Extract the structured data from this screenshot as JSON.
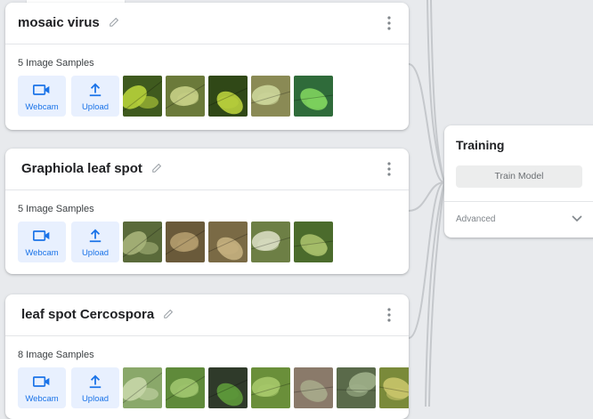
{
  "classes": [
    {
      "name": "mosaic virus",
      "samples_label": "5 Image Samples",
      "webcam_label": "Webcam",
      "upload_label": "Upload",
      "thumbnails": [
        {
          "bg": "#3f5a1e",
          "leaf": "#b7d13a"
        },
        {
          "bg": "#6b7a3a",
          "leaf": "#c7cf86"
        },
        {
          "bg": "#304817",
          "leaf": "#b9cf3c"
        },
        {
          "bg": "#8a8a55",
          "leaf": "#cbd59a"
        },
        {
          "bg": "#2f6b3a",
          "leaf": "#7fd35e"
        }
      ]
    },
    {
      "name": "Graphiola leaf spot",
      "samples_label": "5 Image Samples",
      "webcam_label": "Webcam",
      "upload_label": "Upload",
      "thumbnails": [
        {
          "bg": "#5a6a3a",
          "leaf": "#a7b47a"
        },
        {
          "bg": "#6a5a3a",
          "leaf": "#b49c6e"
        },
        {
          "bg": "#7a6a45",
          "leaf": "#c4b07e"
        },
        {
          "bg": "#6d7f45",
          "leaf": "#d7dcc0"
        },
        {
          "bg": "#4b6b2c",
          "leaf": "#a9c06a"
        }
      ]
    },
    {
      "name": "leaf spot Cercospora",
      "samples_label": "8 Image Samples",
      "webcam_label": "Webcam",
      "upload_label": "Upload",
      "thumbnails": [
        {
          "bg": "#8aa86a",
          "leaf": "#c6d6a8"
        },
        {
          "bg": "#5f8a3a",
          "leaf": "#9fc46e"
        },
        {
          "bg": "#2f3a2a",
          "leaf": "#5e9a3a"
        },
        {
          "bg": "#6a8f3a",
          "leaf": "#a6c86a"
        },
        {
          "bg": "#8a7a6a",
          "leaf": "#a6a88a"
        },
        {
          "bg": "#5a6a4a",
          "leaf": "#9fb08a"
        },
        {
          "bg": "#7a8a3a",
          "leaf": "#c8c46a"
        }
      ]
    }
  ],
  "training": {
    "title": "Training",
    "train_button": "Train Model",
    "advanced_label": "Advanced"
  },
  "colors": {
    "accent": "#1a73e8",
    "accent_bg": "#e8f0fe",
    "canvas": "#e8eaed"
  },
  "icons": {
    "edit": "pencil-icon",
    "menu": "more-vert-icon",
    "webcam": "videocam-icon",
    "upload": "upload-icon",
    "expand": "chevron-down-icon"
  }
}
